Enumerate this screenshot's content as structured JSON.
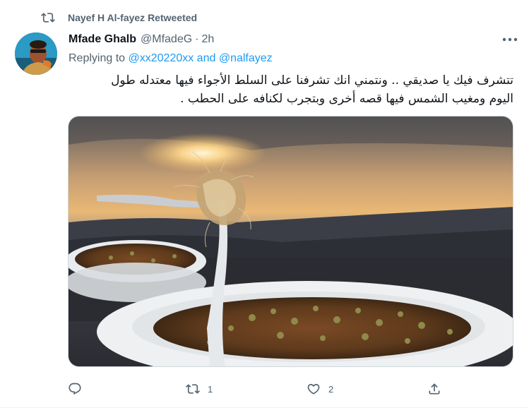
{
  "retweet_context": {
    "icon": "retweet-icon",
    "text": "Nayef H Al-fayez Retweeted"
  },
  "tweet": {
    "author": {
      "display_name": "Mfade Ghalb",
      "handle": "@MfadeG",
      "separator": "·",
      "time": "2h"
    },
    "reply": {
      "prefix": "Replying to ",
      "mention_1": "@xx20220xx",
      "joiner": " and ",
      "mention_2": "@nalfayez"
    },
    "text_line_1": "تتشرف فيك يا صديقي .. ونتمني انك تشرفنا على السلط الأجواء فيها معتدله طول",
    "text_line_2": "اليوم ومغيب الشمس فيها قصه أخرى وبتجرب لكنافه على الحطب .",
    "actions": {
      "reply": {
        "icon": "reply-icon",
        "count": ""
      },
      "retweet": {
        "icon": "retweet-icon",
        "count": "1"
      },
      "like": {
        "icon": "heart-icon",
        "count": "2"
      },
      "share": {
        "icon": "share-icon",
        "count": ""
      }
    }
  },
  "colors": {
    "accent": "#1d9bf0",
    "secondary_text": "#536471",
    "primary_text": "#0f1419"
  }
}
